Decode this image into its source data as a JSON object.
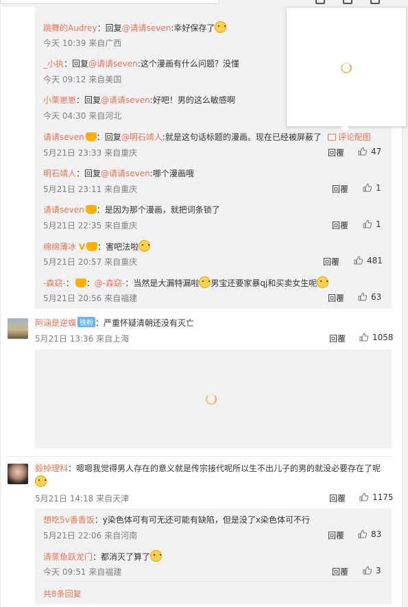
{
  "comments": [
    {
      "replies": [
        {
          "user": "跳舞的Audrey",
          "reply_word": "回复",
          "reply_to": "@请请seven",
          "text": ":幸好保存了",
          "meta": "今天 10:39 来自广西"
        },
        {
          "user": "_小执",
          "reply_word": "回复",
          "reply_to": "@请请seven",
          "text": ":这个漫画有什么问题？没懂",
          "meta": "今天 09:12 来自美国"
        },
        {
          "user": "小栗崽崽",
          "reply_word": "回复",
          "reply_to": "@请请seven",
          "text": ":好吧！男的这么敏感啊",
          "meta": "今天 04:30 来自河北"
        },
        {
          "user": "请请seven",
          "reply_word": "回复",
          "reply_to": "@明石靖人",
          "text": ":就是这句话标题的漫画。现在已经被屏蔽了",
          "meta": "5月21日 23:33 来自重庆",
          "pic_link": "评论配图",
          "reply_label": "回覆",
          "likes": "47"
        },
        {
          "user": "明石靖人",
          "reply_word": "回复",
          "reply_to": "@请请seven",
          "text": ":哪个漫画哦",
          "meta": "5月21日 23:11 来自重庆",
          "reply_label": "回覆",
          "likes": "1"
        },
        {
          "user": "请请seven",
          "text": "是因为那个漫画，就把词条锁了",
          "meta": "5月21日 22:35 来自重庆",
          "reply_label": "回覆",
          "likes": "1"
        },
        {
          "user": "绵绵薄冰",
          "text": "害吧法啦",
          "meta": "5月21日 20:57 来自重庆",
          "reply_label": "回覆",
          "likes": "481"
        },
        {
          "user": "-森窈-",
          "reply_to": "@-森窈-",
          "text": "当然是大漏特漏啦",
          "text2": "男宝还要家暴qj和买卖女生呢",
          "meta": "5月21日 20:56 来自福建",
          "reply_label": "回覆",
          "likes": "63"
        }
      ]
    },
    {
      "user": "阿涵是逆蝶",
      "badge": "铁粉",
      "text": "严重怀疑清朝还没有灭亡",
      "meta": "5月21日 13:36 来自上海",
      "reply_label": "回覆",
      "likes": "1058"
    },
    {
      "user": "毅掉理科",
      "text": "嗯嗯我觉得男人存在的意义就是传宗接代呢所以生不出儿子的男的就没必要存在了呢",
      "meta": "5月21日 14:18 来自天津",
      "reply_label": "回覆",
      "likes": "1175",
      "replies": [
        {
          "user": "想吃5v香香饭",
          "text": "y染色体可有可无还可能有缺陷，但是没了x染色体可不行",
          "meta": "5月21日 22:06 来自河南",
          "reply_label": "回覆",
          "likes": "83"
        },
        {
          "user": "清蒸鱼跃龙门",
          "text": "都消灭了算了",
          "meta": "今天 09:51 来自福建",
          "reply_label": "回覆",
          "likes": "3"
        }
      ],
      "more": "共8条回复"
    }
  ],
  "colors": {
    "username": "#eb7350",
    "meta": "#808080",
    "reply_bg": "#f2f2f5"
  }
}
